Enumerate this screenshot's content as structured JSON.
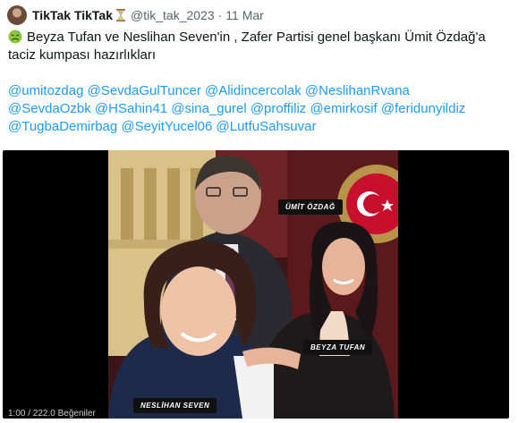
{
  "tweet": {
    "display_name": "TikTak TikTak",
    "handle": "@tik_tak_2023",
    "separator": "·",
    "timestamp": "11 Mar",
    "badge_icon": "hourglass-icon",
    "emoji_icon": "nauseated-face-emoji",
    "line1": "Beyza Tufan ve Neslihan Seven'in , Zafer Partisi genel başkanı Ümit Özdağ'a",
    "line2": "taciz kumpası hazırlıkları",
    "mentions_line1": "@umitozdag @SevdaGulTuncer @Alidincercolak @NeslihanRvana",
    "mentions_line2": "@SevdaOzbk @HSahin41 @sina_gurel @proffiliz  @emirkosif @feridunyildiz",
    "mentions_line3": "@TugbaDemirbag @SeyitYucel06 @LutfuSahsuvar"
  },
  "media": {
    "labels": {
      "top": "ÜMİT ÖZDAĞ",
      "right": "BEYZA TUFAN",
      "bottom": "NESLİHAN SEVEN"
    },
    "player_text": "1:00 / 222.0 Beğeniler"
  },
  "colors": {
    "mention": "#1d9bf0",
    "text": "#0f1419",
    "muted": "#536471",
    "media_bg": "#000000"
  }
}
